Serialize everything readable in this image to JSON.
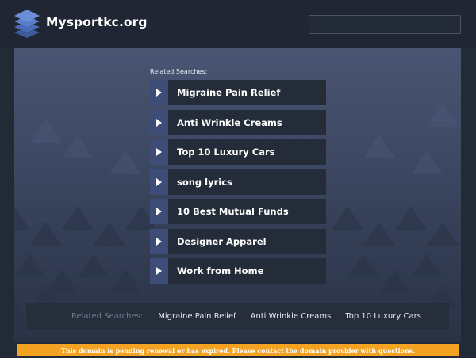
{
  "header": {
    "logo_icon": "stacked-layers-icon",
    "site_title": "Mysportkc.org",
    "search": {
      "value": "",
      "placeholder": ""
    }
  },
  "main": {
    "related_heading": "Related Searches:",
    "links": [
      {
        "label": "Migraine Pain Relief",
        "icon": "play-arrow-icon"
      },
      {
        "label": "Anti Wrinkle Creams",
        "icon": "play-arrow-icon"
      },
      {
        "label": "Top 10 Luxury Cars",
        "icon": "play-arrow-icon"
      },
      {
        "label": "song lyrics",
        "icon": "play-arrow-icon"
      },
      {
        "label": "10 Best Mutual Funds",
        "icon": "play-arrow-icon"
      },
      {
        "label": "Designer Apparel",
        "icon": "play-arrow-icon"
      },
      {
        "label": "Work from Home",
        "icon": "play-arrow-icon"
      }
    ]
  },
  "bottom_bar": {
    "label": "Related Searches:",
    "links": [
      "Migraine Pain Relief",
      "Anti Wrinkle Creams",
      "Top 10 Luxury Cars"
    ]
  },
  "notice": {
    "text": "This domain is pending renewal or has expired. Please contact the domain provider with questions."
  },
  "colors": {
    "page_background": "#222937",
    "panel_top": "#4a5573",
    "panel_bottom": "#2a3346",
    "arrow_box": "#3e4d77",
    "link_box": "#252c39",
    "notice_bar": "#f3a221"
  }
}
